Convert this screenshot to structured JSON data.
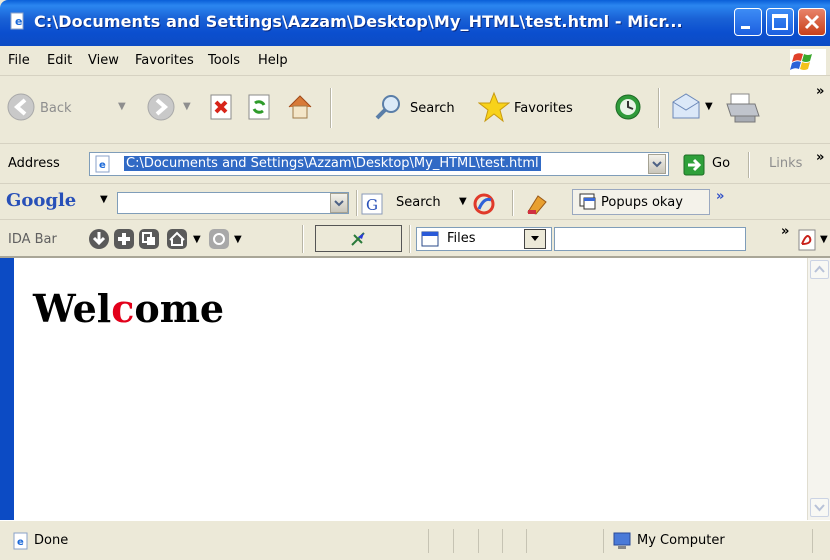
{
  "window": {
    "title": "C:\\Documents and Settings\\Azzam\\Desktop\\My_HTML\\test.html - Micr..."
  },
  "menu": [
    "File",
    "Edit",
    "View",
    "Favorites",
    "Tools",
    "Help"
  ],
  "toolbar": {
    "back_label": "Back",
    "search_label": "Search",
    "favorites_label": "Favorites",
    "more": "»"
  },
  "address": {
    "label": "Address",
    "url": "C:\\Documents and Settings\\Azzam\\Desktop\\My_HTML\\test.html",
    "go_label": "Go",
    "links_label": "Links",
    "more": "»"
  },
  "google_bar": {
    "logo": "Google",
    "search_value": "",
    "search_label": "Search",
    "popups_label": "Popups okay",
    "more": "»"
  },
  "ida_bar": {
    "label": "IDA Bar",
    "files_label": "Files",
    "more": "»"
  },
  "page": {
    "heading_part1": "Wel",
    "heading_red": "c",
    "heading_part2": "ome",
    "red_color": "#e2001a"
  },
  "status": {
    "text": "Done",
    "zone": "My Computer"
  }
}
